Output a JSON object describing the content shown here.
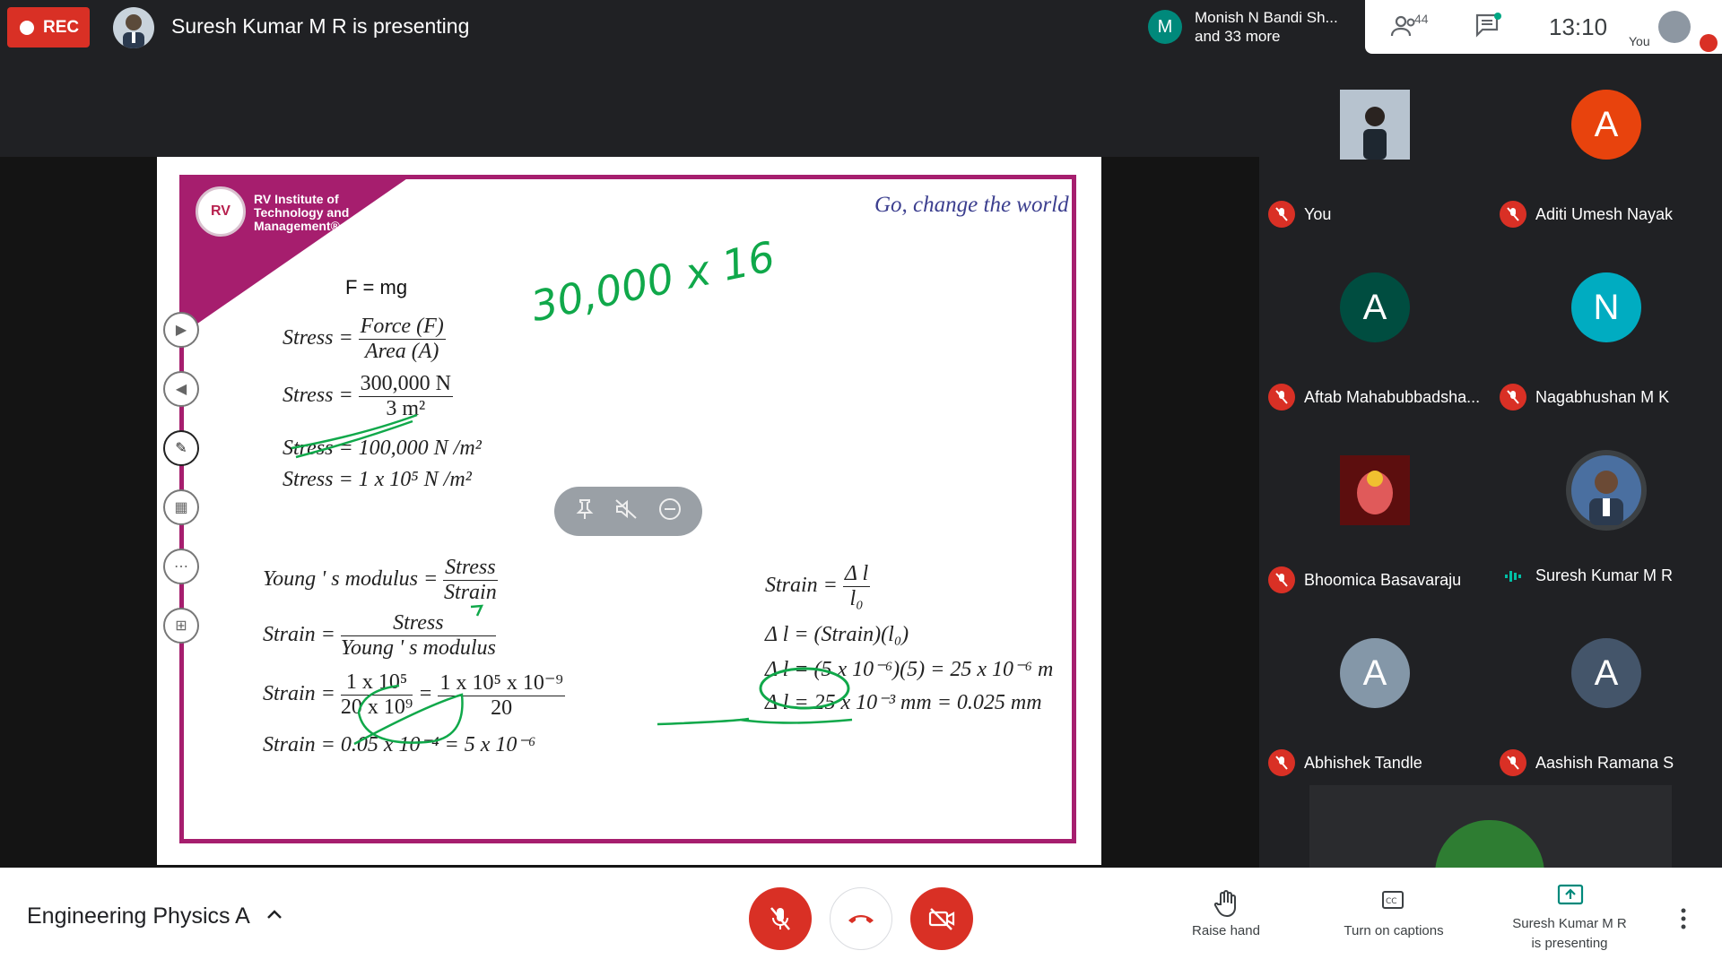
{
  "top": {
    "rec_label": "REC",
    "presenting_text": "Suresh Kumar M R is presenting",
    "who_initial": "M",
    "who_line1": "Monish N Bandi Sh...",
    "who_line2": "and 33 more",
    "participant_count": "44",
    "clock": "13:10",
    "you_label": "You"
  },
  "slide": {
    "logo_abbrev": "RV",
    "logo_line1": "RV Institute of",
    "logo_line2": "Technology and",
    "logo_line3": "Management®",
    "tagline": "Go, change the world",
    "eq_fmg": "F  = mg",
    "stress1_lhs": "Stress =",
    "stress1_num": "Force (F)",
    "stress1_den": "Area (A)",
    "stress2_lhs": "Stress =",
    "stress2_num": "300,000 N",
    "stress2_den": "3 m²",
    "stress3": "Stress = 100,000 N /m²",
    "stress4": "Stress = 1 x 10⁵ N /m²",
    "young_lhs": "Young ' s modulus =",
    "young_num": "Stress",
    "young_den": "Strain",
    "strain1_lhs": "Strain =",
    "strain1_num": "Stress",
    "strain1_den": "Young ' s modulus",
    "strain2_lhs": "Strain =",
    "strain2_num": "1 x 10⁵",
    "strain2_den": "20 x 10⁹",
    "strain2_eq": "=",
    "strain2_num2": "1 x 10⁵ x 10⁻⁹",
    "strain2_den2": "20",
    "strain3": "Strain = 0.05 x 10⁻⁴ = 5 x 10⁻⁶",
    "r_strain_lhs": "Strain =",
    "r_strain_num": "Δ l",
    "r_strain_den": "l₀",
    "r_dl1": "Δ l = (Strain)(l₀)",
    "r_dl2": "Δ l = (5 x 10⁻⁶)(5) = 25 x 10⁻⁶ m",
    "r_dl3": "Δ l = 25 x 10⁻³ mm = 0.025 mm",
    "handwritten": "30,000 x 16"
  },
  "participants": [
    {
      "name": "You",
      "initial": "",
      "color": "#9aa5b1",
      "muted": true
    },
    {
      "name": "Aditi Umesh Nayak",
      "initial": "A",
      "color": "#e8430d",
      "muted": true
    },
    {
      "name": "Aftab Mahabubbadsha...",
      "initial": "A",
      "color": "#004d40",
      "muted": true
    },
    {
      "name": "Nagabhushan M K",
      "initial": "N",
      "color": "#00acc1",
      "muted": true
    },
    {
      "name": "Bhoomica Basavaraju",
      "initial": "",
      "color": "#8b1a1a",
      "muted": true
    },
    {
      "name": "Suresh Kumar M R",
      "initial": "",
      "color": "#4a5a70",
      "muted": false
    },
    {
      "name": "Abhishek Tandle",
      "initial": "A",
      "color": "#8497a8",
      "muted": true
    },
    {
      "name": "Aashish Ramana S",
      "initial": "A",
      "color": "#44556a",
      "muted": true
    }
  ],
  "bottom": {
    "meeting_name": "Engineering Physics A",
    "raise_hand": "Raise hand",
    "captions": "Turn on captions",
    "presenting_line1": "Suresh Kumar M R",
    "presenting_line2": "is presenting"
  },
  "colors": {
    "red": "#d93025",
    "magenta": "#a61e6e",
    "ink_green": "#10a84a"
  }
}
